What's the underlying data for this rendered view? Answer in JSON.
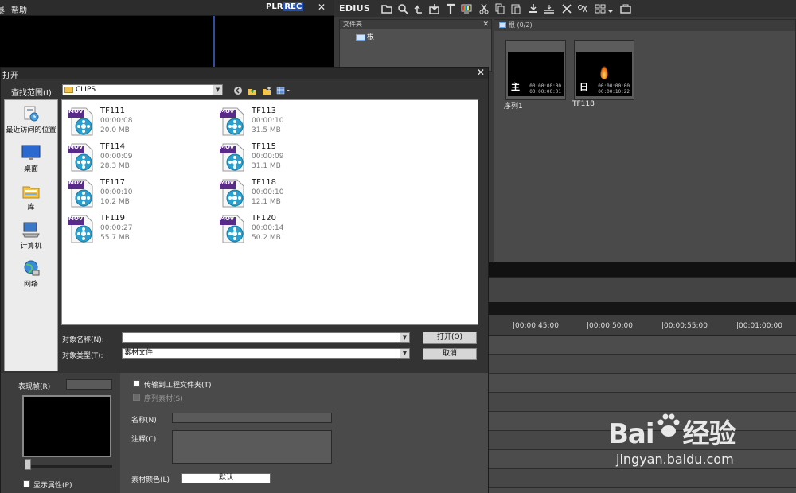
{
  "player": {
    "menu": [
      "帮助"
    ],
    "menu_prefix": "暴",
    "badge_plr": "PLR",
    "badge_rec": "REC",
    "close": "✕"
  },
  "edius": {
    "logo": "EDIUS",
    "toolbar_icons": [
      "folder-icon",
      "search-icon",
      "up-icon",
      "import-icon",
      "title-icon",
      "color-bars-icon",
      "cut-icon",
      "copy-icon",
      "paste-icon",
      "add-to-timeline-icon",
      "insert-icon",
      "delete-icon",
      "properties-icon",
      "view-icon",
      "tools-icon"
    ]
  },
  "folder_panel": {
    "title": "文件夹",
    "close": "✕",
    "root": "根"
  },
  "bin": {
    "header": "根 (0/2)",
    "clips": [
      {
        "name": "序列1",
        "char": "主",
        "tc_in": "00:00:00:00",
        "tc_out": "00:00:00:01"
      },
      {
        "name": "TF118",
        "char": "日",
        "tc_in": "00:00:00:00",
        "tc_out": "00:00:10:22"
      }
    ]
  },
  "timeline": {
    "ruler": [
      "|00:00:45:00",
      "|00:00:50:00",
      "|00:00:55:00",
      "|00:01:00:00"
    ]
  },
  "dialog": {
    "title": "打开",
    "close": "✕",
    "lookin_label": "查找范围(I):",
    "lookin_value": "CLIPS",
    "nav_icons": [
      "back-icon",
      "up-folder-icon",
      "new-folder-icon",
      "view-menu-icon"
    ],
    "places": [
      {
        "label": "最近访问的位置",
        "icon": "recent-places-icon"
      },
      {
        "label": "桌面",
        "icon": "desktop-icon"
      },
      {
        "label": "库",
        "icon": "libraries-icon"
      },
      {
        "label": "计算机",
        "icon": "computer-icon"
      },
      {
        "label": "网络",
        "icon": "network-icon"
      }
    ],
    "file_badge": "MOV",
    "files": [
      {
        "name": "TF111",
        "duration": "00:00:08",
        "size": "20.0 MB"
      },
      {
        "name": "TF113",
        "duration": "00:00:10",
        "size": "31.5 MB"
      },
      {
        "name": "TF114",
        "duration": "00:00:09",
        "size": "28.3 MB"
      },
      {
        "name": "TF115",
        "duration": "00:00:09",
        "size": "31.1 MB"
      },
      {
        "name": "TF117",
        "duration": "00:00:10",
        "size": "10.2 MB"
      },
      {
        "name": "TF118",
        "duration": "00:00:10",
        "size": "12.1 MB"
      },
      {
        "name": "TF119",
        "duration": "00:00:27",
        "size": "55.7 MB"
      },
      {
        "name": "TF120",
        "duration": "00:00:14",
        "size": "50.2 MB"
      }
    ],
    "object_name_label": "对象名称(N):",
    "object_name_value": "",
    "object_type_label": "对象类型(T):",
    "object_type_value": "素材文件",
    "open_button": "打开(O)",
    "cancel_button": "取消",
    "rep_frame_label": "表现帧(R)",
    "transfer_checkbox": "传输到工程文件夹(T)",
    "sequence_checkbox": "序列素材(S)",
    "name_label": "名称(N)",
    "comment_label": "注释(C)",
    "color_label": "素材颜色(L)",
    "color_value": "默认",
    "show_props_checkbox": "显示属性(P)"
  },
  "watermark": {
    "logo_left": "Bai",
    "logo_right": "经验",
    "url": "jingyan.baidu.com"
  }
}
